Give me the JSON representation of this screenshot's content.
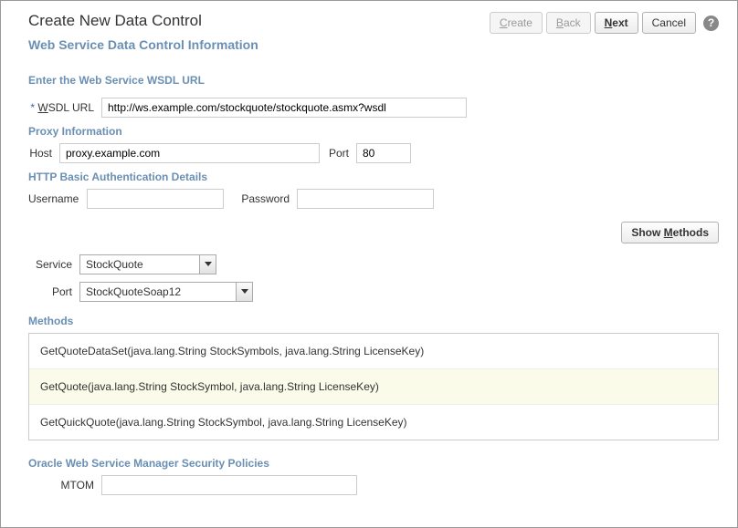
{
  "title": "Create New Data Control",
  "buttons": {
    "create": "Create",
    "back": "Back",
    "next": "Next",
    "cancel": "Cancel",
    "show_methods": "Show Methods"
  },
  "subtitle": "Web Service Data Control Information",
  "sections": {
    "wsdl_url": "Enter the Web Service WSDL URL",
    "proxy": "Proxy Information",
    "http_auth": "HTTP Basic Authentication Details",
    "methods": "Methods",
    "owsm": "Oracle Web Service Manager Security Policies"
  },
  "labels": {
    "wsdl_url": "WSDL URL",
    "host": "Host",
    "port": "Port",
    "username": "Username",
    "password": "Password",
    "service": "Service",
    "port_svc": "Port",
    "mtom": "MTOM"
  },
  "values": {
    "wsdl_url": "http://ws.example.com/stockquote/stockquote.asmx?wsdl",
    "host": "proxy.example.com",
    "port": "80",
    "username": "",
    "password": "",
    "service": "StockQuote",
    "svc_port": "StockQuoteSoap12",
    "mtom": ""
  },
  "methods": [
    "GetQuoteDataSet(java.lang.String StockSymbols, java.lang.String LicenseKey)",
    "GetQuote(java.lang.String StockSymbol, java.lang.String LicenseKey)",
    "GetQuickQuote(java.lang.String StockSymbol, java.lang.String LicenseKey)"
  ]
}
